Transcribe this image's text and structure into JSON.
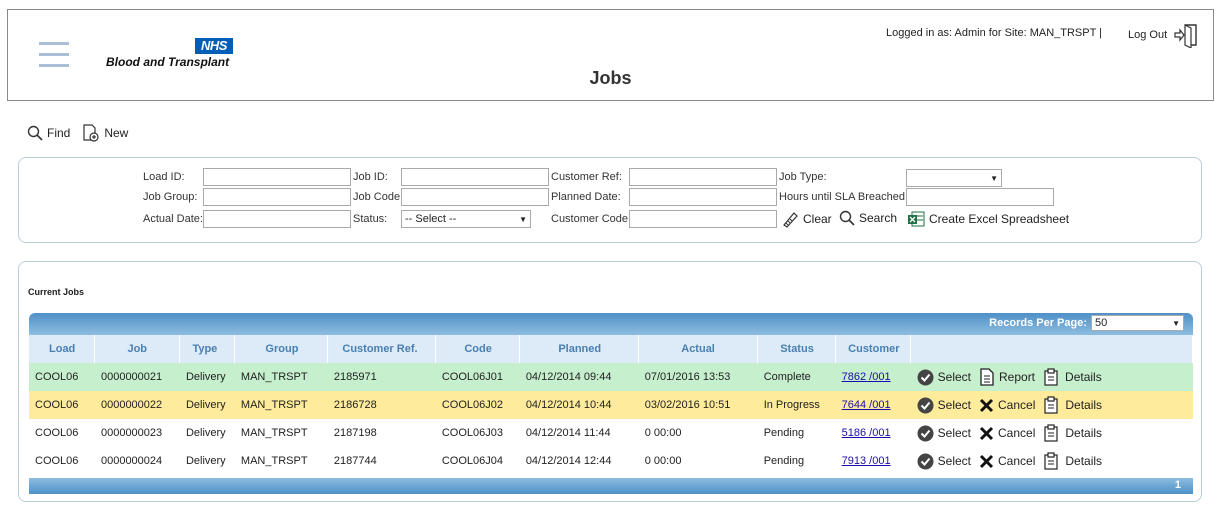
{
  "header": {
    "logo_badge": "NHS",
    "logo_text": "Blood and Transplant",
    "title": "Jobs",
    "logged_in": "Logged in as: Admin for Site: MAN_TRSPT |",
    "logout": "Log Out"
  },
  "toolbar": {
    "find": "Find",
    "new": "New"
  },
  "search": {
    "load_id_label": "Load ID:",
    "job_id_label": "Job ID:",
    "customer_ref_label": "Customer Ref:",
    "job_type_label": "Job Type:",
    "job_group_label": "Job Group:",
    "job_code_label": "Job Code",
    "planned_date_label": "Planned Date:",
    "sla_label": "Hours until SLA Breached",
    "actual_date_label": "Actual Date:",
    "status_label": "Status:",
    "status_value": "-- Select --",
    "customer_code_label": "Customer Code",
    "clear": "Clear",
    "search": "Search",
    "excel": "Create Excel Spreadsheet"
  },
  "jobs": {
    "section_title": "Current Jobs",
    "records_label": "Records Per Page:",
    "records_value": "50",
    "columns": [
      "Load",
      "Job",
      "Type",
      "Group",
      "Customer Ref.",
      "Code",
      "Planned",
      "Actual",
      "Status",
      "Customer"
    ],
    "rows": [
      {
        "load": "COOL06",
        "job": "0000000021",
        "type": "Delivery",
        "group": "MAN_TRSPT",
        "ref": "2185971",
        "code": "COOL06J01",
        "planned": "04/12/2014 09:44",
        "actual": "07/01/2016 13:53",
        "status": "Complete",
        "customer": "7862 /001",
        "select": "Select",
        "action2": "Report",
        "details": "Details"
      },
      {
        "load": "COOL06",
        "job": "0000000022",
        "type": "Delivery",
        "group": "MAN_TRSPT",
        "ref": "2186728",
        "code": "COOL06J02",
        "planned": "04/12/2014 10:44",
        "actual": "03/02/2016 10:51",
        "status": "In Progress",
        "customer": "7644 /001",
        "select": "Select",
        "action2": "Cancel",
        "details": "Details"
      },
      {
        "load": "COOL06",
        "job": "0000000023",
        "type": "Delivery",
        "group": "MAN_TRSPT",
        "ref": "2187198",
        "code": "COOL06J03",
        "planned": "04/12/2014 11:44",
        "actual": "0 00:00",
        "status": "Pending",
        "customer": "5186 /001",
        "select": "Select",
        "action2": "Cancel",
        "details": "Details"
      },
      {
        "load": "COOL06",
        "job": "0000000024",
        "type": "Delivery",
        "group": "MAN_TRSPT",
        "ref": "2187744",
        "code": "COOL06J04",
        "planned": "04/12/2014 12:44",
        "actual": "0 00:00",
        "status": "Pending",
        "customer": "7913 /001",
        "select": "Select",
        "action2": "Cancel",
        "details": "Details"
      }
    ],
    "page": "1"
  }
}
